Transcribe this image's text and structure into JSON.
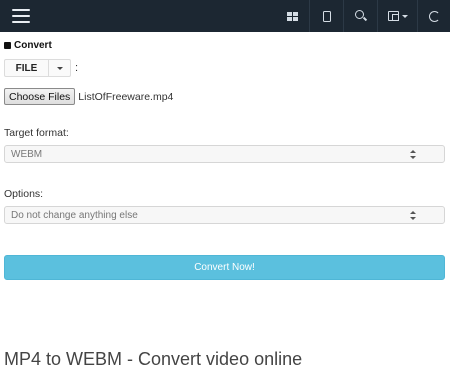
{
  "topbar": {
    "menu_icon": "hamburger-menu-icon",
    "icons": [
      "grid-icon",
      "mobile-icon",
      "search-icon",
      "language-icon",
      "refresh-icon"
    ],
    "background": "#1c2732"
  },
  "convert_section": {
    "heading": "Convert",
    "source_button": "FILE",
    "source_suffix": ":",
    "choose_files_label": "Choose Files",
    "selected_file": "ListOfFreeware.mp4"
  },
  "target_format": {
    "label": "Target format:",
    "selected": "WEBM"
  },
  "options": {
    "label": "Options:",
    "selected": "Do not change anything else"
  },
  "convert_button": {
    "label": "Convert Now!",
    "color": "#5bc0de"
  },
  "page_heading": "MP4 to WEBM - Convert video online"
}
